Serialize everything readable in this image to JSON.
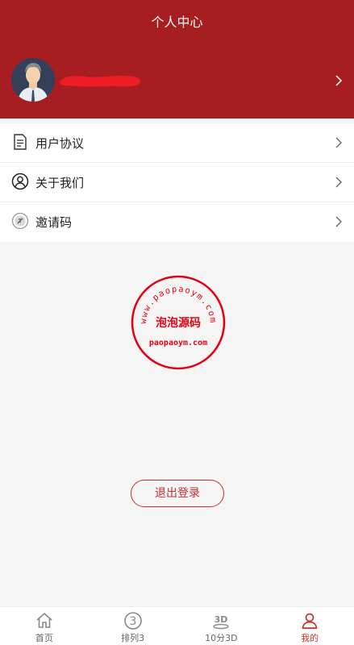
{
  "header": {
    "title": "个人中心"
  },
  "menu": {
    "items": [
      {
        "label": "用户协议",
        "icon": "document-icon"
      },
      {
        "label": "关于我们",
        "icon": "user-circle-icon"
      },
      {
        "label": "邀请码",
        "icon": "invite-code-icon"
      }
    ]
  },
  "watermark": {
    "top_text": "www.paopaoym.com",
    "center_text": "泡泡源码",
    "bottom_text": "paopaoym.com"
  },
  "logout_label": "退出登录",
  "tabbar": {
    "items": [
      {
        "label": "首页",
        "icon": "home-icon",
        "active": false
      },
      {
        "label": "排列3",
        "icon": "circle-3-icon",
        "active": false
      },
      {
        "label": "10分3D",
        "icon": "3d-icon",
        "active": false
      },
      {
        "label": "我的",
        "icon": "user-icon",
        "active": true
      }
    ]
  },
  "colors": {
    "header_bg": "#a61e22",
    "accent": "#c9302c",
    "page_bg": "#f5f5f5",
    "redaction": "#ee1c24"
  }
}
